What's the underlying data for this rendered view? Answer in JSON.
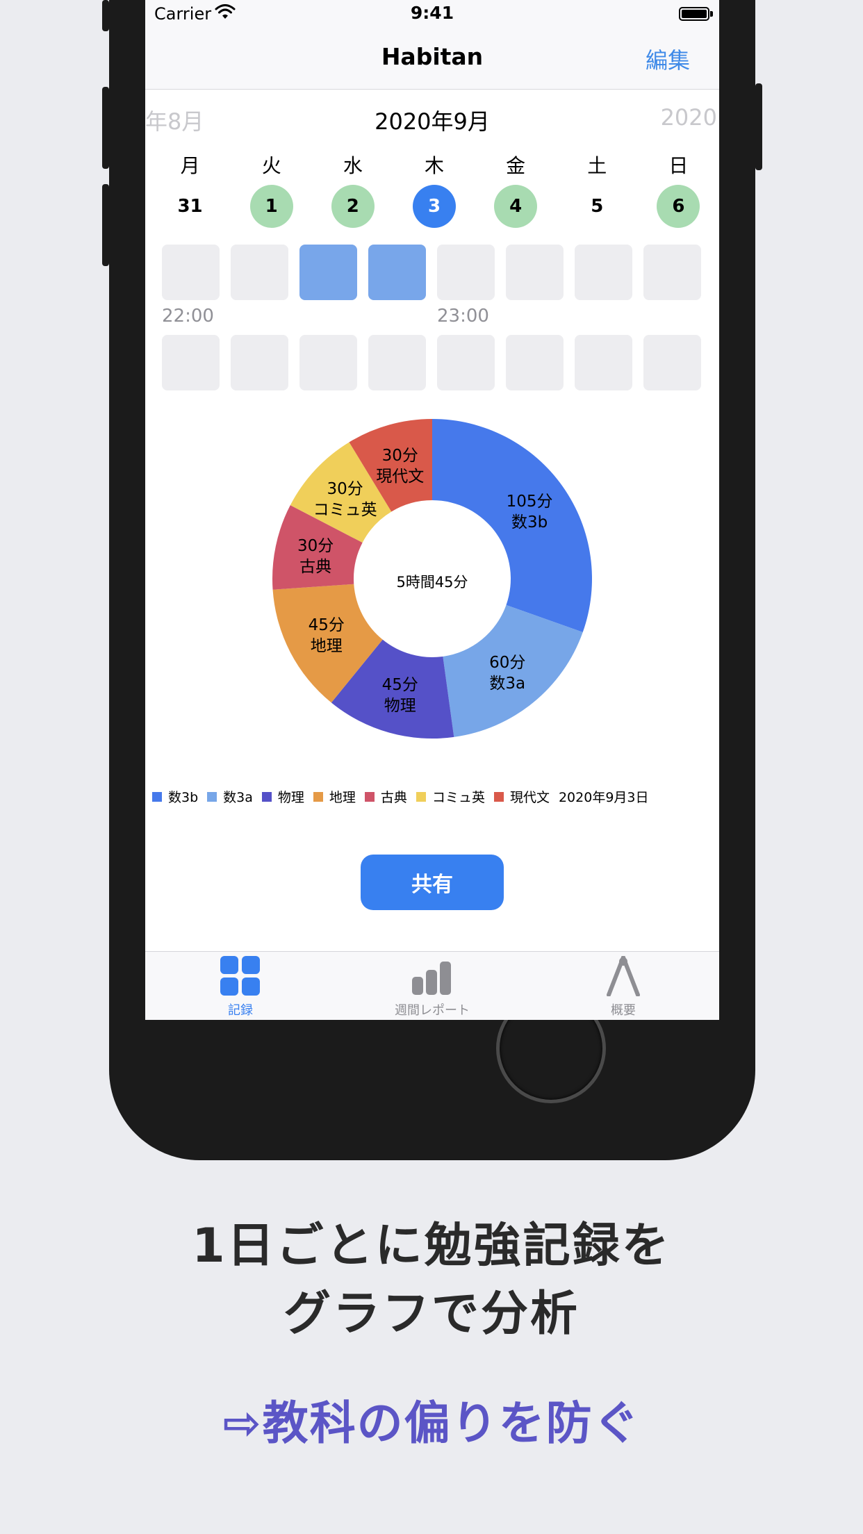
{
  "status_bar": {
    "carrier": "Carrier",
    "time": "9:41"
  },
  "nav": {
    "title": "Habitan",
    "edit": "編集"
  },
  "calendar": {
    "prev_month": "年8月",
    "current_month": "2020年9月",
    "next_month": "2020",
    "weekdays": [
      "月",
      "火",
      "水",
      "木",
      "金",
      "土",
      "日"
    ],
    "days": [
      "31",
      "1",
      "2",
      "3",
      "4",
      "5",
      "6"
    ]
  },
  "time_labels": [
    "22:00",
    "23:00"
  ],
  "chart_data": {
    "type": "pie",
    "center_label": "5時間45分",
    "categories": [
      "数3b",
      "数3a",
      "物理",
      "地理",
      "古典",
      "コミュ英",
      "現代文"
    ],
    "values": [
      105,
      60,
      45,
      45,
      30,
      30,
      30
    ],
    "labels": [
      "105分",
      "60分",
      "45分",
      "45分",
      "30分",
      "30分",
      "30分"
    ],
    "colors": [
      "#4679eb",
      "#77a6e8",
      "#5551c8",
      "#e59a46",
      "#cf5468",
      "#f0cf5a",
      "#d9594a"
    ],
    "legend_date": "2020年9月3日"
  },
  "share_button": "共有",
  "tabs": [
    {
      "label": "記録",
      "icon": "grid-icon"
    },
    {
      "label": "週間レポート",
      "icon": "bar-chart-icon"
    },
    {
      "label": "概要",
      "icon": "compass-icon"
    }
  ],
  "headline": {
    "line1": "1日ごとに勉強記録を",
    "line2": "グラフで分析"
  },
  "subline": "⇨教科の偏りを防ぐ"
}
